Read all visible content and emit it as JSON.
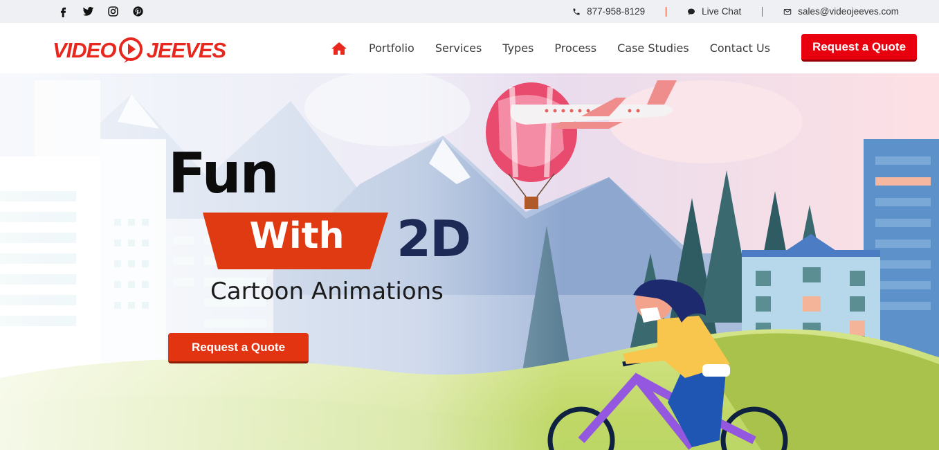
{
  "topbar": {
    "social": [
      "facebook-icon",
      "twitter-icon",
      "instagram-icon",
      "pinterest-icon"
    ],
    "phone": "877-958-8129",
    "chat": "Live Chat",
    "email": "sales@videojeeves.com"
  },
  "header": {
    "logo_left": "VIDEO",
    "logo_right": "JEEVES",
    "nav": [
      "Portfolio",
      "Services",
      "Types",
      "Process",
      "Case Studies",
      "Contact Us"
    ],
    "quote_button": "Request a Quote"
  },
  "hero": {
    "line1": "Fun",
    "line2": "With",
    "line3": "2D",
    "subtitle": "Cartoon Animations",
    "button": "Request a Quote"
  },
  "colors": {
    "brand_red": "#e8281e",
    "button_red": "#e8000f",
    "hero_button": "#e23410",
    "navy": "#1d2a56",
    "topbar_bg": "#eef0f3"
  }
}
